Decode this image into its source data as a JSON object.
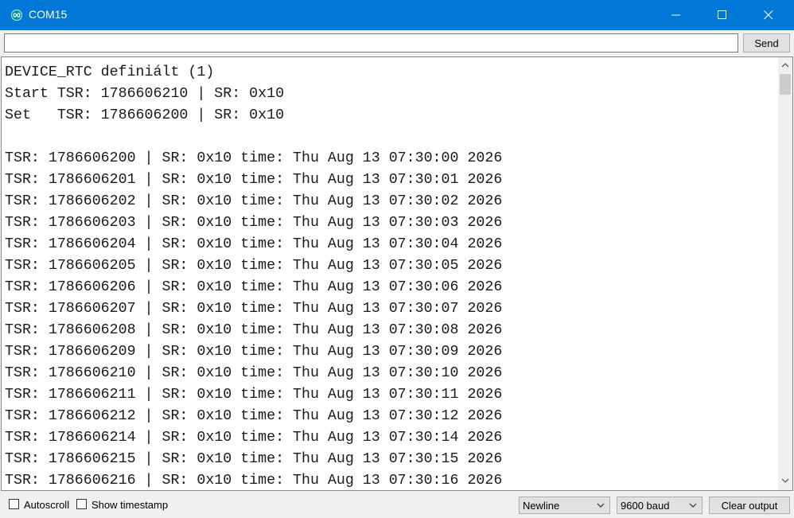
{
  "window": {
    "title": "COM15",
    "app_icon": "arduino-infinity-icon",
    "titlebar_color": "#0078d7"
  },
  "send_bar": {
    "input_value": "",
    "send_label": "Send"
  },
  "output": {
    "lines": [
      "DEVICE_RTC definiált (1)",
      "Start TSR: 1786606210 | SR: 0x10",
      "Set   TSR: 1786606200 | SR: 0x10",
      "",
      "TSR: 1786606200 | SR: 0x10 time: Thu Aug 13 07:30:00 2026",
      "TSR: 1786606201 | SR: 0x10 time: Thu Aug 13 07:30:01 2026",
      "TSR: 1786606202 | SR: 0x10 time: Thu Aug 13 07:30:02 2026",
      "TSR: 1786606203 | SR: 0x10 time: Thu Aug 13 07:30:03 2026",
      "TSR: 1786606204 | SR: 0x10 time: Thu Aug 13 07:30:04 2026",
      "TSR: 1786606205 | SR: 0x10 time: Thu Aug 13 07:30:05 2026",
      "TSR: 1786606206 | SR: 0x10 time: Thu Aug 13 07:30:06 2026",
      "TSR: 1786606207 | SR: 0x10 time: Thu Aug 13 07:30:07 2026",
      "TSR: 1786606208 | SR: 0x10 time: Thu Aug 13 07:30:08 2026",
      "TSR: 1786606209 | SR: 0x10 time: Thu Aug 13 07:30:09 2026",
      "TSR: 1786606210 | SR: 0x10 time: Thu Aug 13 07:30:10 2026",
      "TSR: 1786606211 | SR: 0x10 time: Thu Aug 13 07:30:11 2026",
      "TSR: 1786606212 | SR: 0x10 time: Thu Aug 13 07:30:12 2026",
      "TSR: 1786606214 | SR: 0x10 time: Thu Aug 13 07:30:14 2026",
      "TSR: 1786606215 | SR: 0x10 time: Thu Aug 13 07:30:15 2026",
      "TSR: 1786606216 | SR: 0x10 time: Thu Aug 13 07:30:16 2026"
    ]
  },
  "footer": {
    "autoscroll_label": "Autoscroll",
    "autoscroll_checked": false,
    "timestamp_label": "Show timestamp",
    "timestamp_checked": false,
    "line_ending": "Newline",
    "baud_rate": "9600 baud",
    "clear_label": "Clear output"
  }
}
